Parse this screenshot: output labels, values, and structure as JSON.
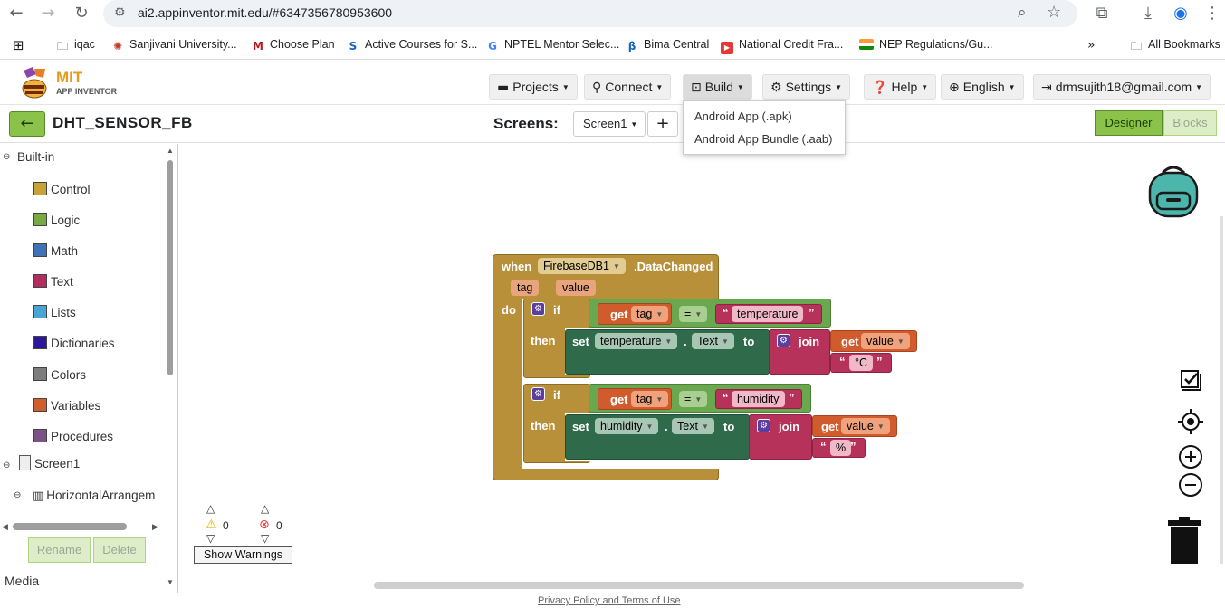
{
  "browser": {
    "url": "ai2.appinventor.mit.edu/#6347356780953600",
    "bookmarks": [
      {
        "label": "iqac",
        "icon": "folder-icon"
      },
      {
        "label": "Sanjivani University...",
        "icon": "bookmark-icon"
      },
      {
        "label": "Choose Plan",
        "icon": "bookmark-icon"
      },
      {
        "label": "Active Courses for S...",
        "icon": "bookmark-icon"
      },
      {
        "label": "NPTEL Mentor Selec...",
        "icon": "google-icon"
      },
      {
        "label": "Bima Central",
        "icon": "bookmark-icon"
      },
      {
        "label": "National Credit Fra...",
        "icon": "youtube-icon"
      },
      {
        "label": "NEP Regulations/Gu...",
        "icon": "flag-icon"
      }
    ],
    "all_bookmarks": "All Bookmarks"
  },
  "app": {
    "logo_title": "MIT",
    "logo_subtitle": "APP INVENTOR",
    "menu": {
      "projects": "Projects",
      "connect": "Connect",
      "build": "Build",
      "settings": "Settings",
      "help": "Help",
      "language": "English",
      "account": "drmsujith18@gmail.com"
    },
    "build_menu": {
      "apk": "Android App (.apk)",
      "aab": "Android App Bundle (.aab)"
    }
  },
  "project": {
    "name": "DHT_SENSOR_FB",
    "screens_label": "Screens:",
    "current_screen": "Screen1",
    "add_screen": "+",
    "designer": "Designer",
    "blocks": "Blocks"
  },
  "panel": {
    "builtin": "Built-in",
    "categories": [
      {
        "label": "Control",
        "color": "#c8a137"
      },
      {
        "label": "Logic",
        "color": "#77ab41"
      },
      {
        "label": "Math",
        "color": "#3f71b5"
      },
      {
        "label": "Text",
        "color": "#b32d5e"
      },
      {
        "label": "Lists",
        "color": "#49a6d4"
      },
      {
        "label": "Dictionaries",
        "color": "#2d1799"
      },
      {
        "label": "Colors",
        "color": "#7d7d7d"
      },
      {
        "label": "Variables",
        "color": "#d05f2d"
      },
      {
        "label": "Procedures",
        "color": "#7c5385"
      }
    ],
    "screen": "Screen1",
    "arrangement": "HorizontalArrangem",
    "rename": "Rename",
    "delete": "Delete",
    "media": "Media"
  },
  "blocks": {
    "event_when": "when",
    "event_component": "FirebaseDB1",
    "event_name": ".DataChanged",
    "param_tag": "tag",
    "param_value": "value",
    "do": "do",
    "if": "if",
    "then": "then",
    "get": "get",
    "eq": "=",
    "set": "set",
    "dot": ".",
    "prop_text": "Text",
    "to": "to",
    "join": "join",
    "if1": {
      "var": "tag",
      "string": "temperature",
      "component": "temperature",
      "join_var": "value",
      "suffix": "°C"
    },
    "if2": {
      "var": "tag",
      "string": "humidity",
      "component": "humidity",
      "join_var": "value",
      "suffix": "%"
    }
  },
  "warnings": {
    "warning_count": "0",
    "error_count": "0",
    "show_warnings": "Show Warnings"
  },
  "footer": {
    "privacy": "Privacy Policy and Terms of Use"
  }
}
